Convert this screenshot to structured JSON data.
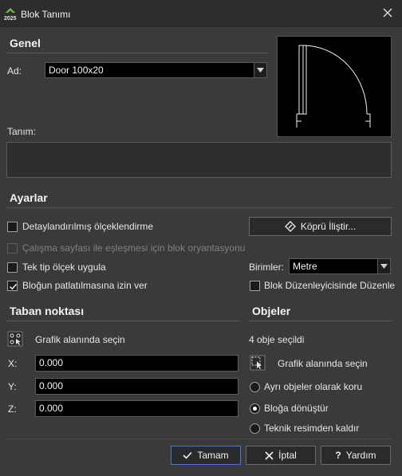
{
  "window": {
    "title": "Blok Tanımı",
    "app_icon": "app-logo-icon",
    "app_icon_text": "2025"
  },
  "general": {
    "heading": "Genel",
    "name_label": "Ad:",
    "name_value": "Door 100x20",
    "description_label": "Tanım:",
    "description_value": ""
  },
  "settings": {
    "heading": "Ayarlar",
    "annotative_label": "Detaylandırılmış ölçeklendirme",
    "annotative_checked": false,
    "match_orientation_label": "Çalışma sayfası ile eşleşmesi için blok oryantasyonu",
    "match_orientation_checked": false,
    "uniform_scale_label": "Tek tip ölçek uygula",
    "uniform_scale_checked": false,
    "allow_explode_label": "Bloğun patlatılmasına izin ver",
    "allow_explode_checked": true,
    "hyperlink_button": "Köprü İliştir...",
    "units_label": "Birimler:",
    "units_value": "Metre",
    "open_in_editor_label": "Blok Düzenleyicisinde Düzenle",
    "open_in_editor_checked": false
  },
  "base_point": {
    "heading": "Taban noktası",
    "pick_label": "Grafik alanında seçin",
    "x_label": "X:",
    "x_value": "0.000",
    "y_label": "Y:",
    "y_value": "0.000",
    "z_label": "Z:",
    "z_value": "0.000"
  },
  "objects": {
    "heading": "Objeler",
    "count_text": "4 obje seçildi",
    "select_label": "Grafik alanında seçin",
    "options": [
      {
        "label": "Ayrı objeler olarak koru",
        "selected": false
      },
      {
        "label": "Bloğa dönüştür",
        "selected": true
      },
      {
        "label": "Teknik resimden kaldır",
        "selected": false
      }
    ]
  },
  "buttons": {
    "ok": "Tamam",
    "cancel": "İptal",
    "help": "Yardım"
  },
  "colors": {
    "background": "#3a3a3a",
    "titlebar": "#2d2d2d",
    "field": "#000000",
    "accent": "#3d7bd8"
  }
}
